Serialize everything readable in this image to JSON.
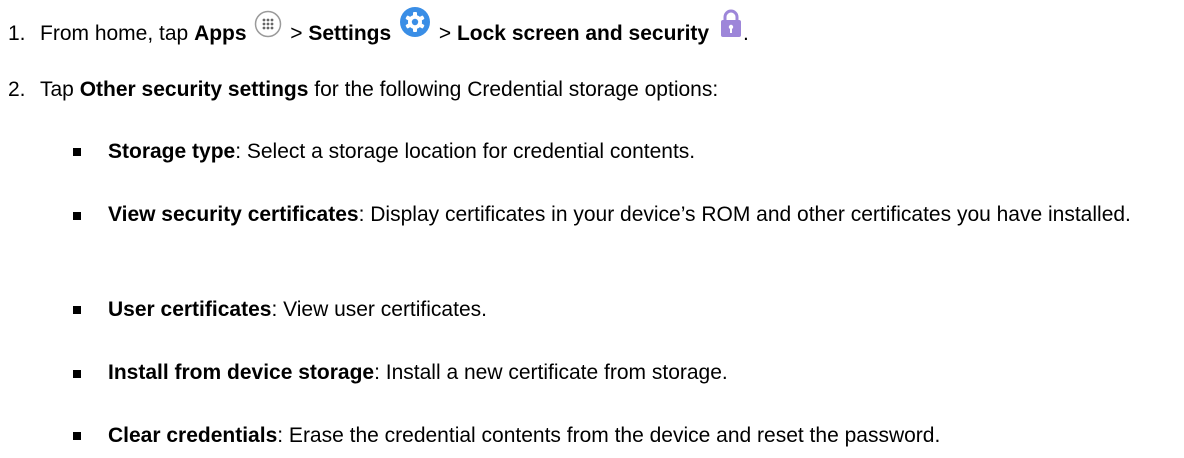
{
  "steps": [
    {
      "number": "1.",
      "prefix": "From home, tap ",
      "apps": "Apps",
      "sep1": " > ",
      "settings": "Settings",
      "sep2": " > ",
      "lock": "Lock screen and security",
      "end": "."
    },
    {
      "number": "2.",
      "prefix": "Tap ",
      "bold": "Other security settings",
      "suffix": " for the following Credential storage options:"
    }
  ],
  "bullets": [
    {
      "term": "Storage type",
      "desc": ": Select a storage location for credential contents."
    },
    {
      "term": "View security certificates",
      "desc": ": Display certificates in your device’s ROM and other certificates you have installed."
    },
    {
      "term": "User certificates",
      "desc": ": View user certificates."
    },
    {
      "term": "Install from device storage",
      "desc": ": Install a new certificate from storage."
    },
    {
      "term": "Clear credentials",
      "desc": ": Erase the credential contents from the device and reset the password."
    }
  ],
  "icons": {
    "apps": "apps-grid-icon",
    "settings": "settings-gear-icon",
    "lock": "lock-icon"
  },
  "colors": {
    "settings_blue": "#3a8ee6",
    "lock_purple": "#9d86d9"
  }
}
